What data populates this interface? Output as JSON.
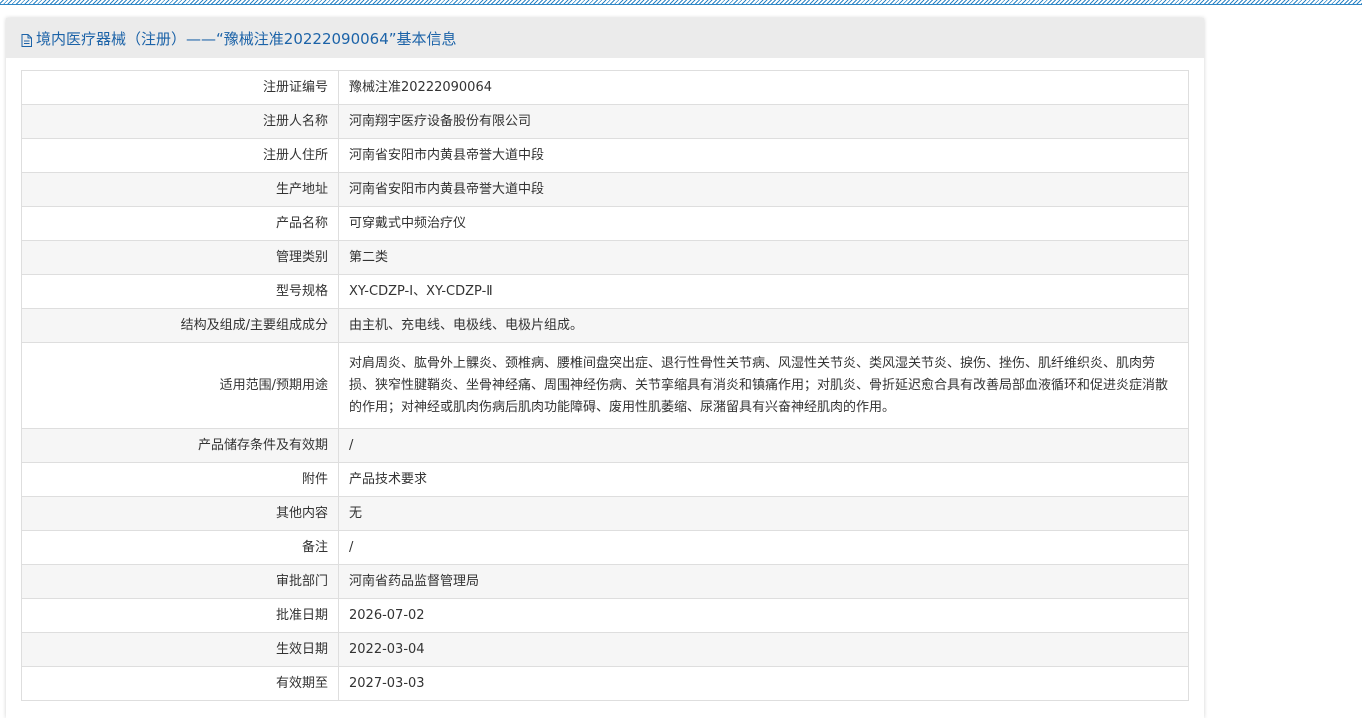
{
  "header": {
    "title": "境内医疗器械（注册）——“豫械注准20222090064”基本信息",
    "icon": "document-icon",
    "title_color": "#1c63a8"
  },
  "rows": [
    {
      "label": "注册证编号",
      "value": "豫械注准20222090064"
    },
    {
      "label": "注册人名称",
      "value": "河南翔宇医疗设备股份有限公司"
    },
    {
      "label": "注册人住所",
      "value": "河南省安阳市内黄县帝誉大道中段"
    },
    {
      "label": "生产地址",
      "value": "河南省安阳市内黄县帝誉大道中段"
    },
    {
      "label": "产品名称",
      "value": "可穿戴式中频治疗仪"
    },
    {
      "label": "管理类别",
      "value": "第二类"
    },
    {
      "label": "型号规格",
      "value": "XY-CDZP-Ⅰ、XY-CDZP-Ⅱ"
    },
    {
      "label": "结构及组成/主要组成成分",
      "value": "由主机、充电线、电极线、电极片组成。"
    },
    {
      "label": "适用范围/预期用途",
      "value": "对肩周炎、肱骨外上髁炎、颈椎病、腰椎间盘突出症、退行性骨性关节病、风湿性关节炎、类风湿关节炎、捩伤、挫伤、肌纤维织炎、肌肉劳损、狭窄性腱鞘炎、坐骨神经痛、周围神经伤病、关节挛缩具有消炎和镇痛作用；对肌炎、骨折延迟愈合具有改善局部血液循环和促进炎症消散的作用；对神经或肌肉伤病后肌肉功能障碍、废用性肌萎缩、尿潴留具有兴奋神经肌肉的作用。"
    },
    {
      "label": "产品储存条件及有效期",
      "value": "/"
    },
    {
      "label": "附件",
      "value": "产品技术要求"
    },
    {
      "label": "其他内容",
      "value": "无"
    },
    {
      "label": "备注",
      "value": "/"
    },
    {
      "label": "审批部门",
      "value": "河南省药品监督管理局"
    },
    {
      "label": "批准日期",
      "value": "2026-07-02"
    },
    {
      "label": "生效日期",
      "value": "2022-03-04"
    },
    {
      "label": "有效期至",
      "value": "2027-03-03"
    }
  ]
}
